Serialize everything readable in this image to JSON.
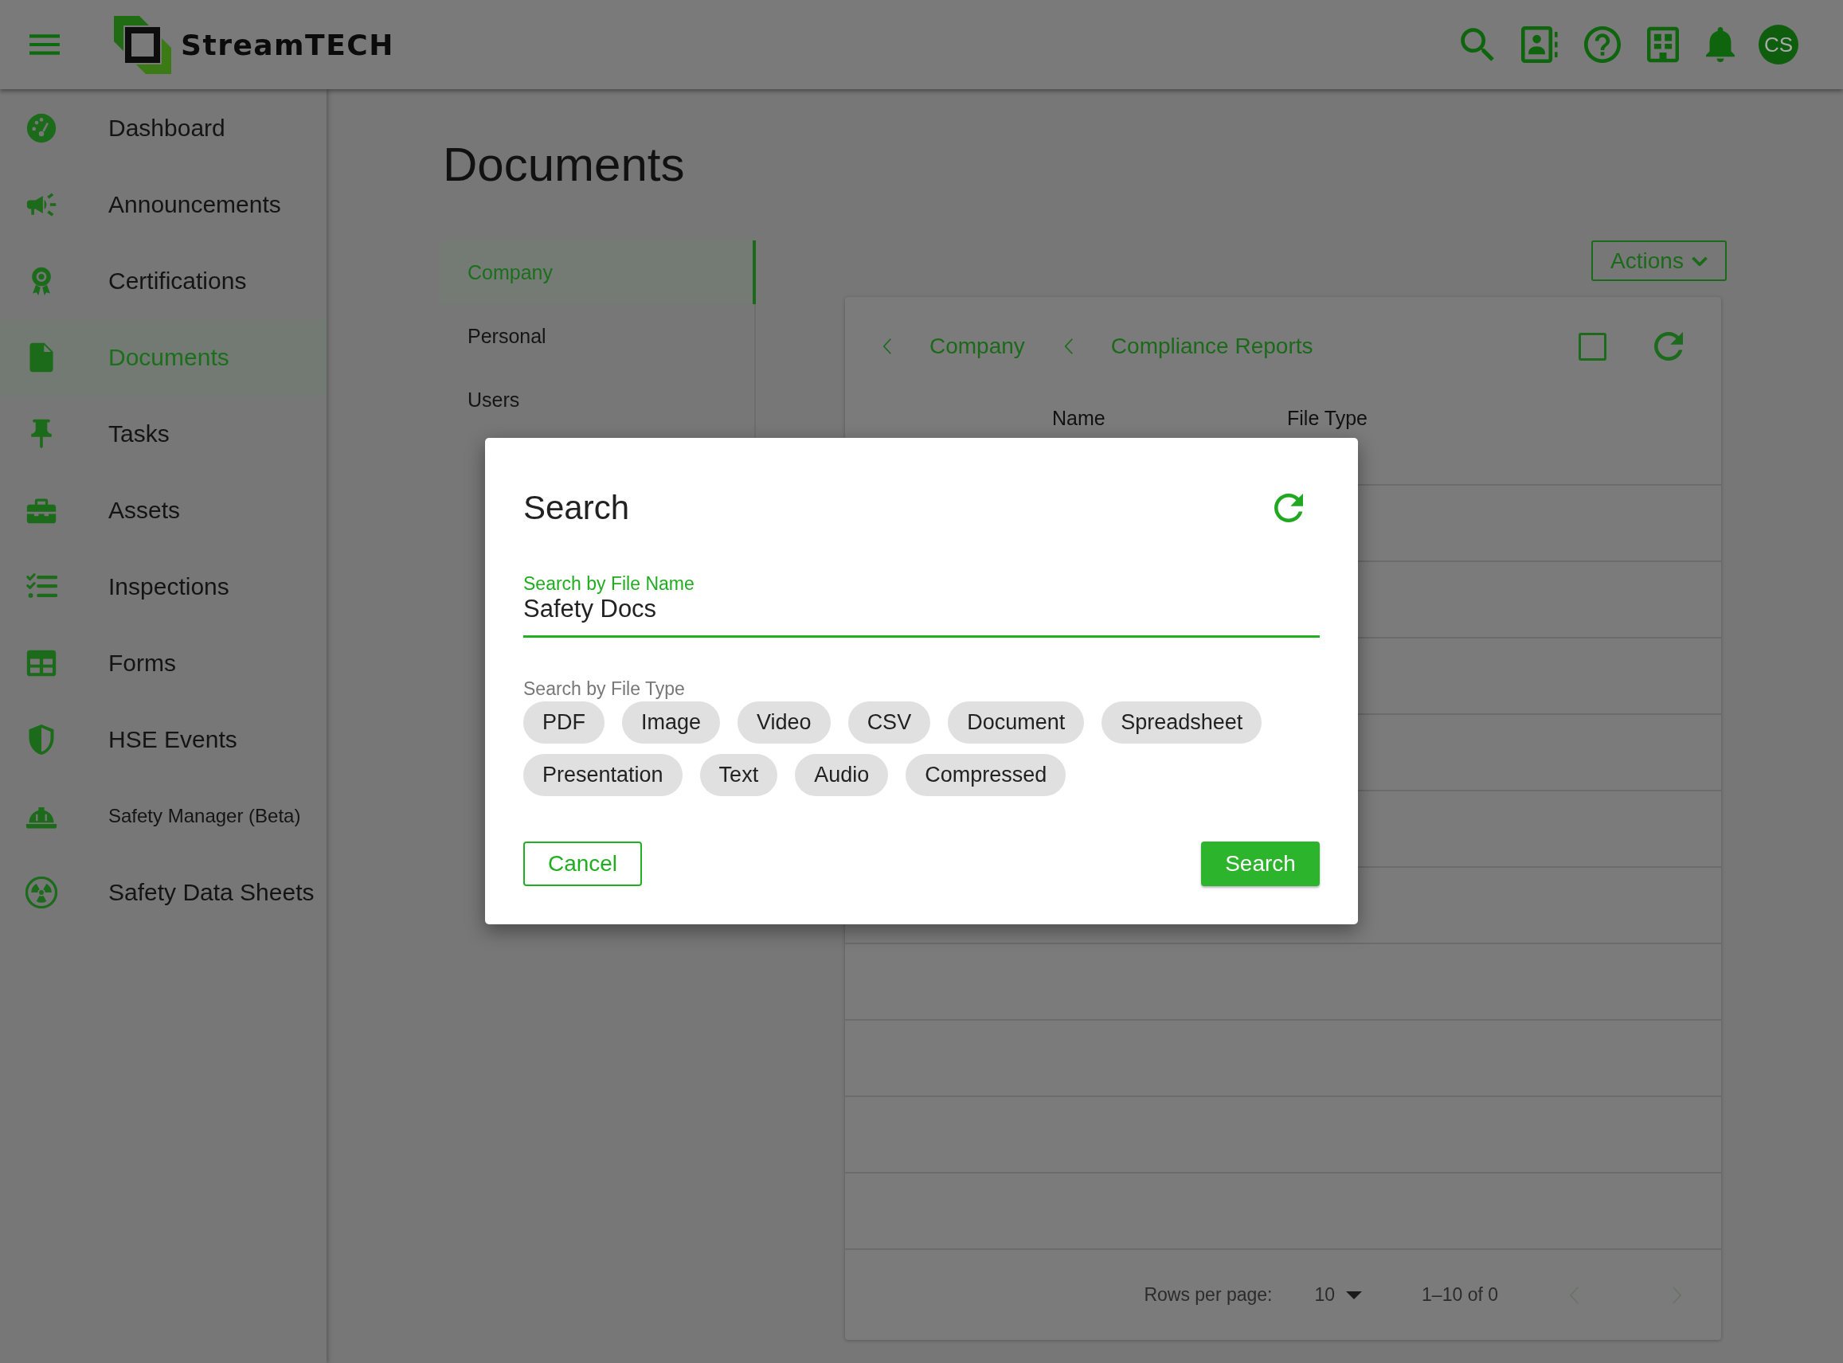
{
  "top_bar": {
    "logo_text": "StreamTECH",
    "avatar_initials": "CS"
  },
  "sidebar": {
    "items": [
      {
        "label": "Dashboard",
        "kind": "normal",
        "selected": false
      },
      {
        "label": "Announcements",
        "kind": "normal",
        "selected": false
      },
      {
        "label": "Certifications",
        "kind": "normal",
        "selected": false
      },
      {
        "label": "Documents",
        "kind": "normal",
        "selected": true
      },
      {
        "label": "Tasks",
        "kind": "normal",
        "selected": false
      },
      {
        "label": "Assets",
        "kind": "normal",
        "selected": false
      },
      {
        "label": "Inspections",
        "kind": "normal",
        "selected": false
      },
      {
        "label": "Forms",
        "kind": "normal",
        "selected": false
      },
      {
        "label": "HSE Events",
        "kind": "normal",
        "selected": false
      },
      {
        "label": "Safety Manager (Beta)",
        "kind": "compact",
        "selected": false
      },
      {
        "label": "Safety Data Sheets",
        "kind": "normal",
        "selected": false
      }
    ]
  },
  "page": {
    "title": "Documents"
  },
  "tabs": [
    {
      "label": "Company",
      "selected": true
    },
    {
      "label": "Personal",
      "selected": false
    },
    {
      "label": "Users",
      "selected": false
    }
  ],
  "actions_button": {
    "label": "Actions"
  },
  "breadcrumb": [
    {
      "label": "Company"
    },
    {
      "label": "Compliance Reports"
    }
  ],
  "select_all": {
    "checked": false
  },
  "table": {
    "columns": [
      "Name",
      "File Type"
    ]
  },
  "pagination": {
    "rows_per_page_label": "Rows per page:",
    "rows_per_page": "10",
    "range": "1–10 of 0",
    "previous_disabled": true,
    "next_disabled": true
  },
  "dialog": {
    "title": "Search",
    "file_name_field": {
      "label": "Search by File Name",
      "value": "Safety Docs",
      "focused": true
    },
    "file_type_label": "Search by File Type",
    "file_types": [
      {
        "label": "PDF",
        "selected": false
      },
      {
        "label": "Image",
        "selected": false
      },
      {
        "label": "Video",
        "selected": false
      },
      {
        "label": "CSV",
        "selected": false
      },
      {
        "label": "Document",
        "selected": false
      },
      {
        "label": "Spreadsheet",
        "selected": false
      },
      {
        "label": "Presentation",
        "selected": false
      },
      {
        "label": "Text",
        "selected": false
      },
      {
        "label": "Audio",
        "selected": false
      },
      {
        "label": "Compressed",
        "selected": false
      }
    ],
    "buttons": [
      {
        "label": "Cancel",
        "kind": "outlined"
      },
      {
        "label": "Search",
        "kind": "filled"
      }
    ]
  }
}
